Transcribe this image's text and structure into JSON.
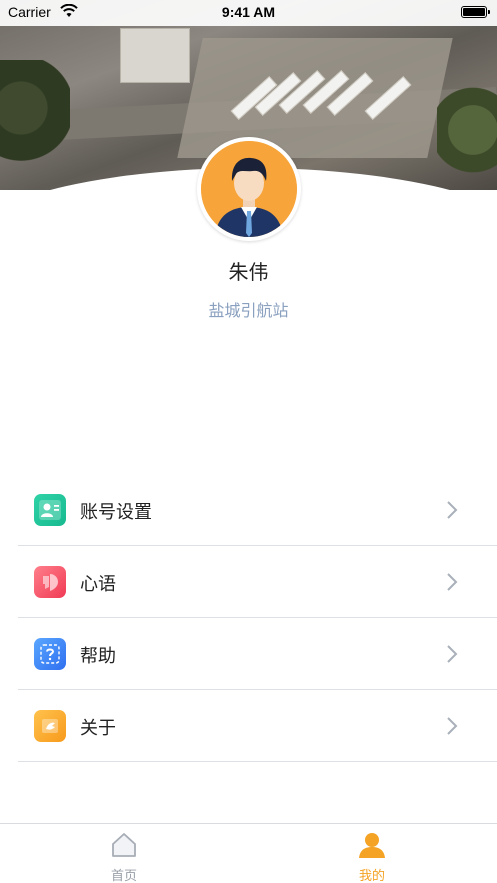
{
  "status_bar": {
    "carrier": "Carrier",
    "time": "9:41 AM"
  },
  "profile": {
    "name": "朱伟",
    "station": "盐城引航站"
  },
  "menu": [
    {
      "label": "账号设置",
      "icon": "account-card-icon",
      "color": "#1fc59a"
    },
    {
      "label": "心语",
      "icon": "heart-message-icon",
      "color": "#f2475e"
    },
    {
      "label": "帮助",
      "icon": "help-question-icon",
      "color": "#3b82f6"
    },
    {
      "label": "关于",
      "icon": "about-info-icon",
      "color": "#f8a62a"
    }
  ],
  "tabbar": {
    "home_label": "首页",
    "mine_label": "我的",
    "active": "mine",
    "active_color": "#f4a325",
    "inactive_color": "#9aa0a8"
  }
}
